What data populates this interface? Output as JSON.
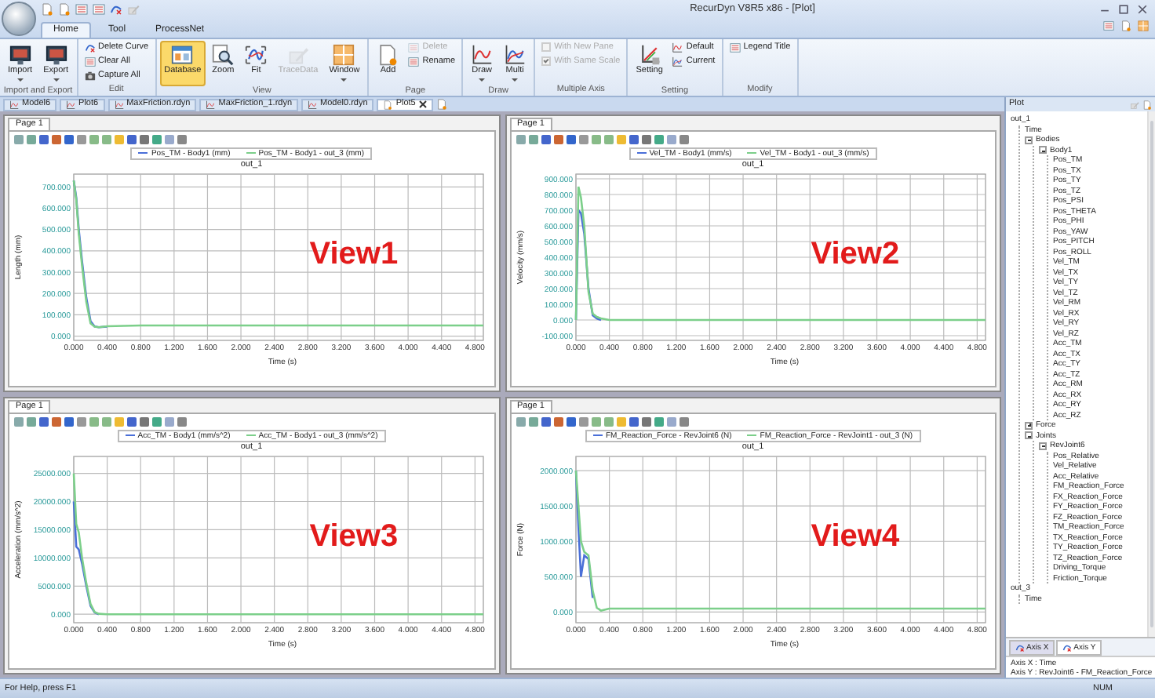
{
  "window": {
    "title": "RecurDyn V8R5 x86 - [Plot]"
  },
  "ribbon": {
    "tabs": [
      {
        "label": "Home",
        "selected": true
      },
      {
        "label": "Tool",
        "selected": false
      },
      {
        "label": "ProcessNet",
        "selected": false
      }
    ],
    "groups": [
      {
        "label": "Import and Export",
        "items": [
          {
            "kind": "large",
            "label": "Import",
            "dropdown": true,
            "disabled": false,
            "on": false
          },
          {
            "kind": "large",
            "label": "Export",
            "dropdown": true,
            "disabled": false,
            "on": false
          }
        ]
      },
      {
        "label": "Edit",
        "items": [
          {
            "kind": "small",
            "label": "Delete Curve",
            "dropdown": false,
            "disabled": false,
            "on": false
          },
          {
            "kind": "small",
            "label": "Clear All",
            "dropdown": false,
            "disabled": false,
            "on": false
          },
          {
            "kind": "small",
            "label": "Capture All",
            "dropdown": false,
            "disabled": false,
            "on": false
          }
        ]
      },
      {
        "label": "View",
        "items": [
          {
            "kind": "large",
            "label": "Database",
            "dropdown": false,
            "disabled": false,
            "on": true
          },
          {
            "kind": "large",
            "label": "Zoom",
            "dropdown": false,
            "disabled": false,
            "on": false
          },
          {
            "kind": "large",
            "label": "Fit",
            "dropdown": false,
            "disabled": false,
            "on": false
          },
          {
            "kind": "large",
            "label": "TraceData",
            "dropdown": false,
            "disabled": true,
            "on": false
          },
          {
            "kind": "large",
            "label": "Window",
            "dropdown": true,
            "disabled": false,
            "on": false
          }
        ]
      },
      {
        "label": "Page",
        "items": [
          {
            "kind": "large",
            "label": "Add",
            "dropdown": false,
            "disabled": false,
            "on": false
          },
          {
            "kind": "small",
            "label": "Delete",
            "dropdown": false,
            "disabled": true,
            "on": false
          },
          {
            "kind": "small",
            "label": "Rename",
            "dropdown": false,
            "disabled": false,
            "on": false
          }
        ]
      },
      {
        "label": "Draw",
        "items": [
          {
            "kind": "large",
            "label": "Draw",
            "dropdown": true,
            "disabled": false,
            "on": false
          },
          {
            "kind": "large",
            "label": "Multi",
            "dropdown": true,
            "disabled": false,
            "on": false
          }
        ]
      },
      {
        "label": "Multiple Axis",
        "items": [
          {
            "kind": "check",
            "label": "With New Pane",
            "checked": false,
            "disabled": true
          },
          {
            "kind": "check",
            "label": "With Same Scale",
            "checked": true,
            "disabled": true
          }
        ]
      },
      {
        "label": "Setting",
        "items": [
          {
            "kind": "large",
            "label": "Setting",
            "dropdown": false,
            "disabled": false,
            "on": false
          },
          {
            "kind": "small",
            "label": "Default",
            "dropdown": false,
            "disabled": false,
            "on": false
          },
          {
            "kind": "small",
            "label": "Current",
            "dropdown": false,
            "disabled": false,
            "on": false
          }
        ]
      },
      {
        "label": "Modify",
        "items": [
          {
            "kind": "small",
            "label": "Legend Title",
            "dropdown": false,
            "disabled": false,
            "on": false
          }
        ]
      }
    ]
  },
  "document_tabs": [
    {
      "label": "Model6",
      "selected": false
    },
    {
      "label": "Plot6",
      "selected": false
    },
    {
      "label": "MaxFriction.rdyn",
      "selected": false
    },
    {
      "label": "MaxFriction_1.rdyn",
      "selected": false
    },
    {
      "label": "Model0.rdyn",
      "selected": false
    },
    {
      "label": "Plot5",
      "selected": true
    }
  ],
  "plot_views": [
    {
      "page_tab": "Page 1",
      "overlay_label": "View1",
      "chart_data": {
        "type": "line",
        "title": "out_1",
        "xlabel": "Time (s)",
        "ylabel": "Length (mm)",
        "grid": true,
        "legend": true,
        "xlim": [
          0,
          4.9
        ],
        "ylim": [
          -20,
          760
        ],
        "x": [
          0,
          0.03,
          0.06,
          0.1,
          0.15,
          0.2,
          0.25,
          0.3,
          0.4,
          0.8,
          1.6,
          2.4,
          3.2,
          4.0,
          4.9
        ],
        "series": [
          {
            "name": "Pos_TM - Body1 (mm)",
            "color": "#4a6fd8",
            "values": [
              730,
              650,
              500,
              350,
              180,
              70,
              45,
              42,
              45,
              null,
              null,
              null,
              null,
              null,
              null
            ]
          },
          {
            "name": "Pos_TM - Body1 - out_3 (mm)",
            "color": "#7ccf8a",
            "values": [
              730,
              640,
              480,
              330,
              160,
              60,
              44,
              42,
              46,
              50,
              50,
              50,
              50,
              50,
              50
            ]
          }
        ],
        "xticks": [
          {
            "value": 0,
            "label": "0.000"
          },
          {
            "value": 0.4,
            "label": "0.400"
          },
          {
            "value": 0.8,
            "label": "0.800"
          },
          {
            "value": 1.2,
            "label": "1.200"
          },
          {
            "value": 1.6,
            "label": "1.600"
          },
          {
            "value": 2.0,
            "label": "2.000"
          },
          {
            "value": 2.4,
            "label": "2.400"
          },
          {
            "value": 2.8,
            "label": "2.800"
          },
          {
            "value": 3.2,
            "label": "3.200"
          },
          {
            "value": 3.6,
            "label": "3.600"
          },
          {
            "value": 4.0,
            "label": "4.000"
          },
          {
            "value": 4.4,
            "label": "4.400"
          },
          {
            "value": 4.8,
            "label": "4.800"
          }
        ],
        "yticks": [
          {
            "value": 0,
            "label": "0.000"
          },
          {
            "value": 100,
            "label": "100.000"
          },
          {
            "value": 200,
            "label": "200.000"
          },
          {
            "value": 300,
            "label": "300.000"
          },
          {
            "value": 400,
            "label": "400.000"
          },
          {
            "value": 500,
            "label": "500.000"
          },
          {
            "value": 600,
            "label": "600.000"
          },
          {
            "value": 700,
            "label": "700.000"
          }
        ]
      }
    },
    {
      "page_tab": "Page 1",
      "overlay_label": "View2",
      "chart_data": {
        "type": "line",
        "title": "out_1",
        "xlabel": "Time (s)",
        "ylabel": "Velocity (mm/s)",
        "grid": true,
        "legend": true,
        "xlim": [
          0,
          4.9
        ],
        "ylim": [
          -130,
          930
        ],
        "x": [
          0,
          0.03,
          0.06,
          0.1,
          0.15,
          0.2,
          0.25,
          0.3,
          0.4,
          0.8,
          1.6,
          2.4,
          3.2,
          4.0,
          4.9
        ],
        "series": [
          {
            "name": "Vel_TM - Body1 (mm/s)",
            "color": "#4a6fd8",
            "values": [
              0,
              700,
              680,
              550,
              200,
              30,
              10,
              0,
              null,
              null,
              null,
              null,
              null,
              null,
              null
            ]
          },
          {
            "name": "Vel_TM - Body1 - out_3 (mm/s)",
            "color": "#7ccf8a",
            "values": [
              0,
              850,
              780,
              600,
              180,
              40,
              20,
              10,
              0,
              0,
              0,
              0,
              0,
              0,
              0
            ]
          }
        ],
        "xticks": [
          {
            "value": 0,
            "label": "0.000"
          },
          {
            "value": 0.4,
            "label": "0.400"
          },
          {
            "value": 0.8,
            "label": "0.800"
          },
          {
            "value": 1.2,
            "label": "1.200"
          },
          {
            "value": 1.6,
            "label": "1.600"
          },
          {
            "value": 2.0,
            "label": "2.000"
          },
          {
            "value": 2.4,
            "label": "2.400"
          },
          {
            "value": 2.8,
            "label": "2.800"
          },
          {
            "value": 3.2,
            "label": "3.200"
          },
          {
            "value": 3.6,
            "label": "3.600"
          },
          {
            "value": 4.0,
            "label": "4.000"
          },
          {
            "value": 4.4,
            "label": "4.400"
          },
          {
            "value": 4.8,
            "label": "4.800"
          }
        ],
        "yticks": [
          {
            "value": -100,
            "label": "-100.000"
          },
          {
            "value": 0,
            "label": "0.000"
          },
          {
            "value": 100,
            "label": "100.000"
          },
          {
            "value": 200,
            "label": "200.000"
          },
          {
            "value": 300,
            "label": "300.000"
          },
          {
            "value": 400,
            "label": "400.000"
          },
          {
            "value": 500,
            "label": "500.000"
          },
          {
            "value": 600,
            "label": "600.000"
          },
          {
            "value": 700,
            "label": "700.000"
          },
          {
            "value": 800,
            "label": "800.000"
          },
          {
            "value": 900,
            "label": "900.000"
          }
        ]
      }
    },
    {
      "page_tab": "Page 1",
      "overlay_label": "View3",
      "chart_data": {
        "type": "line",
        "title": "out_1",
        "xlabel": "Time (s)",
        "ylabel": "Acceleration (mm/s^2)",
        "grid": true,
        "legend": true,
        "xlim": [
          0,
          4.9
        ],
        "ylim": [
          -1500,
          28000
        ],
        "x": [
          0,
          0.03,
          0.06,
          0.1,
          0.15,
          0.2,
          0.25,
          0.3,
          0.4,
          0.8,
          1.6,
          2.4,
          3.2,
          4.0,
          4.9
        ],
        "series": [
          {
            "name": "Acc_TM - Body1 (mm/s^2)",
            "color": "#4a6fd8",
            "values": [
              20000,
              12000,
              11500,
              9000,
              5000,
              1500,
              300,
              0,
              null,
              null,
              null,
              null,
              null,
              null,
              null
            ]
          },
          {
            "name": "Acc_TM - Body1 - out_3 (mm/s^2)",
            "color": "#7ccf8a",
            "values": [
              25000,
              16000,
              14500,
              10000,
              5500,
              1800,
              400,
              100,
              0,
              0,
              0,
              0,
              0,
              0,
              0
            ]
          }
        ],
        "xticks": [
          {
            "value": 0,
            "label": "0.000"
          },
          {
            "value": 0.4,
            "label": "0.400"
          },
          {
            "value": 0.8,
            "label": "0.800"
          },
          {
            "value": 1.2,
            "label": "1.200"
          },
          {
            "value": 1.6,
            "label": "1.600"
          },
          {
            "value": 2.0,
            "label": "2.000"
          },
          {
            "value": 2.4,
            "label": "2.400"
          },
          {
            "value": 2.8,
            "label": "2.800"
          },
          {
            "value": 3.2,
            "label": "3.200"
          },
          {
            "value": 3.6,
            "label": "3.600"
          },
          {
            "value": 4.0,
            "label": "4.000"
          },
          {
            "value": 4.4,
            "label": "4.400"
          },
          {
            "value": 4.8,
            "label": "4.800"
          }
        ],
        "yticks": [
          {
            "value": 0,
            "label": "0.000"
          },
          {
            "value": 5000,
            "label": "5000.000"
          },
          {
            "value": 10000,
            "label": "10000.000"
          },
          {
            "value": 15000,
            "label": "15000.000"
          },
          {
            "value": 20000,
            "label": "20000.000"
          },
          {
            "value": 25000,
            "label": "25000.000"
          }
        ]
      }
    },
    {
      "page_tab": "Page 1",
      "overlay_label": "View4",
      "chart_data": {
        "type": "line",
        "title": "out_1",
        "xlabel": "Time (s)",
        "ylabel": "Force (N)",
        "grid": true,
        "legend": true,
        "xlim": [
          0,
          4.9
        ],
        "ylim": [
          -150,
          2200
        ],
        "x": [
          0,
          0.03,
          0.06,
          0.1,
          0.15,
          0.2,
          0.25,
          0.3,
          0.4,
          0.8,
          1.6,
          2.4,
          3.2,
          4.0,
          4.9
        ],
        "series": [
          {
            "name": "FM_Reaction_Force - RevJoint6 (N)",
            "color": "#4a6fd8",
            "values": [
              2000,
              1200,
              500,
              800,
              750,
              200,
              null,
              null,
              null,
              null,
              null,
              null,
              null,
              null,
              null
            ]
          },
          {
            "name": "FM_Reaction_Force - RevJoint1 - out_3 (N)",
            "color": "#7ccf8a",
            "values": [
              2000,
              1500,
              1000,
              850,
              800,
              300,
              60,
              20,
              50,
              50,
              50,
              50,
              50,
              50,
              50
            ]
          }
        ],
        "xticks": [
          {
            "value": 0,
            "label": "0.000"
          },
          {
            "value": 0.4,
            "label": "0.400"
          },
          {
            "value": 0.8,
            "label": "0.800"
          },
          {
            "value": 1.2,
            "label": "1.200"
          },
          {
            "value": 1.6,
            "label": "1.600"
          },
          {
            "value": 2.0,
            "label": "2.000"
          },
          {
            "value": 2.4,
            "label": "2.400"
          },
          {
            "value": 2.8,
            "label": "2.800"
          },
          {
            "value": 3.2,
            "label": "3.200"
          },
          {
            "value": 3.6,
            "label": "3.600"
          },
          {
            "value": 4.0,
            "label": "4.000"
          },
          {
            "value": 4.4,
            "label": "4.400"
          },
          {
            "value": 4.8,
            "label": "4.800"
          }
        ],
        "yticks": [
          {
            "value": 0,
            "label": "0.000"
          },
          {
            "value": 500,
            "label": "500.000"
          },
          {
            "value": 1000,
            "label": "1000.000"
          },
          {
            "value": 1500,
            "label": "1500.000"
          },
          {
            "value": 2000,
            "label": "2000.000"
          }
        ]
      }
    }
  ],
  "plot_panel": {
    "title": "Plot",
    "tree": [
      {
        "label": "out_1",
        "children": [
          {
            "label": "Time"
          },
          {
            "label": "Bodies",
            "expanded": true,
            "children": [
              {
                "label": "Body1",
                "expanded": true,
                "children": [
                  {
                    "label": "Pos_TM"
                  },
                  {
                    "label": "Pos_TX"
                  },
                  {
                    "label": "Pos_TY"
                  },
                  {
                    "label": "Pos_TZ"
                  },
                  {
                    "label": "Pos_PSI"
                  },
                  {
                    "label": "Pos_THETA"
                  },
                  {
                    "label": "Pos_PHI"
                  },
                  {
                    "label": "Pos_YAW"
                  },
                  {
                    "label": "Pos_PITCH"
                  },
                  {
                    "label": "Pos_ROLL"
                  },
                  {
                    "label": "Vel_TM"
                  },
                  {
                    "label": "Vel_TX"
                  },
                  {
                    "label": "Vel_TY"
                  },
                  {
                    "label": "Vel_TZ"
                  },
                  {
                    "label": "Vel_RM"
                  },
                  {
                    "label": "Vel_RX"
                  },
                  {
                    "label": "Vel_RY"
                  },
                  {
                    "label": "Vel_RZ"
                  },
                  {
                    "label": "Acc_TM"
                  },
                  {
                    "label": "Acc_TX"
                  },
                  {
                    "label": "Acc_TY"
                  },
                  {
                    "label": "Acc_TZ"
                  },
                  {
                    "label": "Acc_RM"
                  },
                  {
                    "label": "Acc_RX"
                  },
                  {
                    "label": "Acc_RY"
                  },
                  {
                    "label": "Acc_RZ"
                  }
                ]
              }
            ]
          },
          {
            "label": "Force",
            "expanded": false
          },
          {
            "label": "Joints",
            "expanded": true,
            "children": [
              {
                "label": "RevJoint6",
                "expanded": true,
                "children": [
                  {
                    "label": "Pos_Relative"
                  },
                  {
                    "label": "Vel_Relative"
                  },
                  {
                    "label": "Acc_Relative"
                  },
                  {
                    "label": "FM_Reaction_Force"
                  },
                  {
                    "label": "FX_Reaction_Force"
                  },
                  {
                    "label": "FY_Reaction_Force"
                  },
                  {
                    "label": "FZ_Reaction_Force"
                  },
                  {
                    "label": "TM_Reaction_Force"
                  },
                  {
                    "label": "TX_Reaction_Force"
                  },
                  {
                    "label": "TY_Reaction_Force"
                  },
                  {
                    "label": "TZ_Reaction_Force"
                  },
                  {
                    "label": "Driving_Torque"
                  },
                  {
                    "label": "Friction_Torque"
                  }
                ]
              }
            ]
          }
        ]
      },
      {
        "label": "out_3",
        "children": [
          {
            "label": "Time"
          }
        ]
      }
    ],
    "axis_tabs": [
      {
        "label": "Axis X",
        "selected": false
      },
      {
        "label": "Axis Y",
        "selected": true
      }
    ],
    "info_lines": [
      "Axis X : Time",
      "Axis Y : RevJoint6 - FM_Reaction_Force"
    ]
  },
  "status_bar": {
    "help": "For Help, press F1",
    "indicator": "NUM"
  }
}
